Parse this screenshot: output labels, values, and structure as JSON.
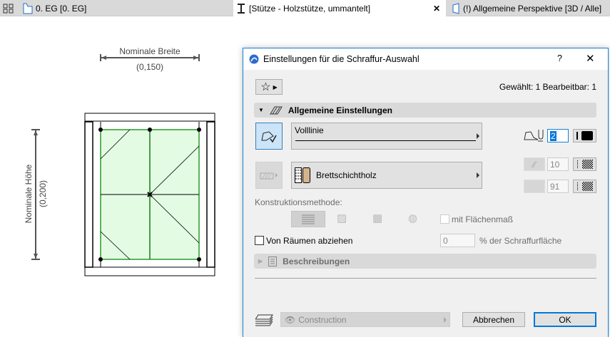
{
  "tabs": [
    {
      "label": "0. EG [0. EG]",
      "icon": "floor-plan-icon"
    },
    {
      "label": "[Stütze - Holzstütze, ummantelt]",
      "icon": "column-icon",
      "active": true
    },
    {
      "label": "(!) Allgemeine Perspektive [3D / Alle]",
      "icon": "3d-view-icon"
    }
  ],
  "drawing": {
    "width_label": "Nominale Breite",
    "width_value": "(0,150)",
    "height_label": "Nominale Höhe",
    "height_value": "(0,200)"
  },
  "dialog": {
    "title": "Einstellungen für die Schraffur-Auswahl",
    "help": "?",
    "selection_info": "Gewählt: 1 Bearbeitbar: 1",
    "general_section": "Allgemeine Einstellungen",
    "line_type": "Volllinie",
    "contour_pen": "2",
    "fill_name": "Brettschichtholz",
    "fg_pen": "10",
    "bg_pen": "91",
    "construction_method_label": "Konstruktionsmethode:",
    "area_text_label": "mit Flächenmaß",
    "subtract_rooms_label": "Von Räumen abziehen",
    "percent_value": "0",
    "percent_label": "% der Schraffurfläche",
    "descriptions_section": "Beschreibungen",
    "layer": "Construction",
    "cancel": "Abbrechen",
    "ok": "OK"
  },
  "colors": {
    "accent": "#1883d7",
    "fill_green": "#e3fbe3",
    "outline_green": "#2a9a2a"
  }
}
